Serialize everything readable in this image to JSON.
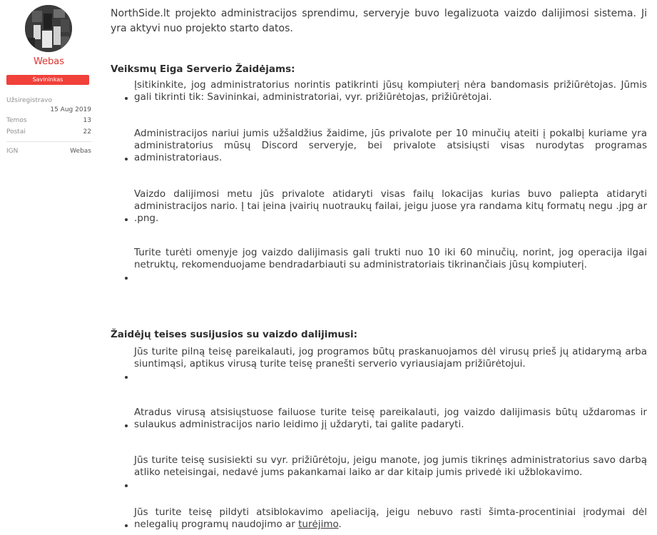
{
  "sidebar": {
    "username": "Webas",
    "role_badge": "Savininkas",
    "stats": [
      {
        "label": "Užsiregistravo",
        "value": "15 Aug 2019"
      },
      {
        "label": "Temos",
        "value": "13"
      },
      {
        "label": "Postai",
        "value": "22"
      },
      {
        "label": "IGN",
        "value": "Webas"
      }
    ]
  },
  "post": {
    "intro": "NorthSide.lt projekto administracijos sprendimu, serveryje buvo legalizuota vaizdo dalijimosi sistema. Ji yra aktyvi nuo projekto starto datos.",
    "sections": [
      {
        "heading": "Veiksmų Eiga Serverio Žaidėjams:",
        "items": [
          "Įsitikinkite, jog administratorius norintis patikrinti jūsų kompiuterį nėra bandomasis prižiūrėtojas. Jūmis gali tikrinti tik: Savininkai, administratoriai, vyr. prižiūrėtojas, prižiūrėtojai.",
          "Administracijos nariui jumis užšaldžius žaidime, jūs privalote per 10 minučių ateiti į pokalbį kuriame yra administratorius mūsų Discord serveryje, bei privalote atsisiųsti visas nurodytas programas administratoriaus.",
          "Vaizdo dalijimosi metu jūs privalote atidaryti visas failų lokacijas kurias buvo paliepta atidaryti administracijos nario. Į tai įeina įvairių nuotraukų failai, jeigu juose yra randama kitų formatų negu .jpg ar .png.",
          "Turite turėti omenyje jog vaizdo dalijimasis gali trukti nuo 10 iki 60 minučių, norint, jog operacija ilgai netruktų, rekomenduojame bendradarbiauti su administratoriais tikrinančiais jūsų kompiuterį."
        ]
      },
      {
        "heading": "Žaidėjų teises susijusios su vaizdo dalijimusi:",
        "items": [
          " Jūs turite pilną teisę pareikalauti, jog programos būtų praskanuojamos dėl virusų prieš jų atidarymą arba siuntimąsi, aptikus virusą turite teisę pranešti serverio vyriausiajam prižiūrėtojui.",
          "Atradus virusą atsisiųstuose failuose turite teisę pareikalauti, jog vaizdo dalijimasis būtų uždaromas ir sulaukus administracijos nario leidimo jį uždaryti, tai galite padaryti.",
          "Jūs turite teisę susisiekti su vyr. prižiūrėtoju, jeigu manote, jog jumis tikrinęs administratorius savo darbą atliko neteisingai, nedavė jums pakankamai laiko ar dar kitaip jumis privedė iki užblokavimo."
        ],
        "last_item": {
          "text": "Jūs turite teisę pildyti atsiblokavimo apeliaciją, jeigu nebuvo rasti šimta-procentiniai įrodymai dėl nelegalių programų naudojimo ar ",
          "link": "turėjimo",
          "after": "."
        }
      }
    ]
  }
}
